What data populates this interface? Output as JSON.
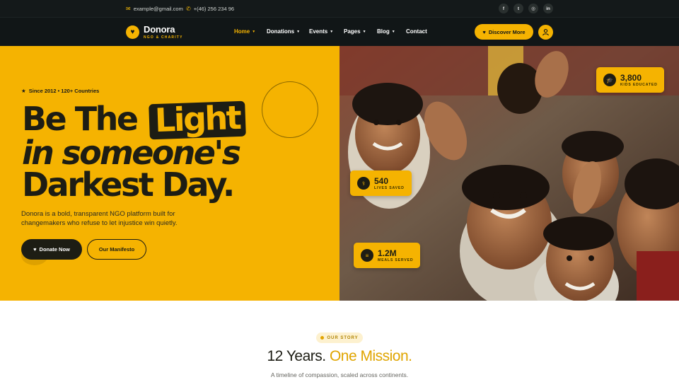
{
  "topbar": {
    "email": "example@gmail.com",
    "phone": "+(46) 256 234 96",
    "socials": [
      {
        "icon": "facebook-icon",
        "glyph": "f"
      },
      {
        "icon": "twitter-icon",
        "glyph": "t"
      },
      {
        "icon": "instagram-icon",
        "glyph": "◎"
      },
      {
        "icon": "linkedin-icon",
        "glyph": "in"
      }
    ]
  },
  "header": {
    "brand_name": "Donora",
    "brand_tagline": "NGO & CHARITY",
    "nav": [
      {
        "label": "Home",
        "has_dropdown": true,
        "active": true
      },
      {
        "label": "Donations",
        "has_dropdown": true,
        "active": false
      },
      {
        "label": "Events",
        "has_dropdown": true,
        "active": false
      },
      {
        "label": "Pages",
        "has_dropdown": true,
        "active": false
      },
      {
        "label": "Blog",
        "has_dropdown": true,
        "active": false
      },
      {
        "label": "Contact",
        "has_dropdown": false,
        "active": false
      }
    ],
    "cta_label": "Discover More"
  },
  "hero": {
    "eyebrow": "Since 2012 • 120+ Countries",
    "headline_part1": "Be The",
    "headline_highlight": "Light",
    "headline_line2": "in someone's",
    "headline_line3": "Darkest Day.",
    "lead": "Donora is a bold, transparent NGO platform built for changemakers who refuse to let injustice win quietly.",
    "primary_button": "Donate Now",
    "secondary_button": "Our Manifesto",
    "stats": [
      {
        "value": "3,800",
        "label": "KIDS EDUCATED",
        "icon": "graduation-cap-icon"
      },
      {
        "value": "540",
        "label": "LIVES SAVED",
        "icon": "stethoscope-icon"
      },
      {
        "value": "1.2M",
        "label": "MEALS SERVED",
        "icon": "burger-icon"
      }
    ]
  },
  "story": {
    "eyebrow": "OUR STORY",
    "title_part1": "12 Years.",
    "title_accent": "One Mission.",
    "subtitle": "A timeline of compassion, scaled across continents."
  },
  "colors": {
    "accent": "#f5b301",
    "dark": "#111617",
    "ink": "#1d1d14"
  }
}
